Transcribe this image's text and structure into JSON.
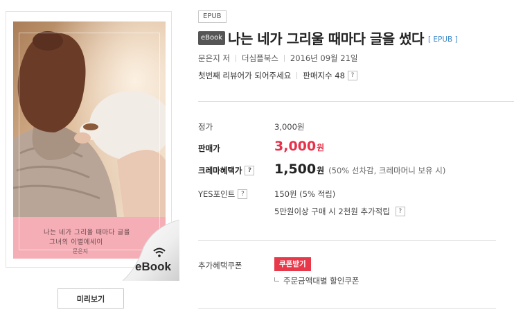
{
  "format_tag": "EPUB",
  "title_row": {
    "ebook_chip": "eBook",
    "title": "나는 네가 그리울 때마다 글을 썼다",
    "format_link": "[ EPUB ]"
  },
  "meta": {
    "author": "문은지 저",
    "publisher": "더심플북스",
    "date": "2016년 09월 21일"
  },
  "review": {
    "text": "첫번째 리뷰어가 되어주세요",
    "sales_index": "판매지수 48",
    "help": "?"
  },
  "cover": {
    "title_line1": "나는 네가 그리울 때마다 글을",
    "title_line2": "그녀의 이별에세이",
    "author": "문은지",
    "badge": "eBook",
    "image_alt": "book cover",
    "colors": {
      "pink": "#f5aeb6",
      "sweater": "#b9a597",
      "hair": "#6a3c28"
    }
  },
  "preview_button": "미리보기",
  "prices": {
    "list_label": "정가",
    "list_value": "3,000원",
    "sale_label": "판매가",
    "sale_value": "3,000",
    "sale_unit": "원",
    "crema_label": "크레마혜택가",
    "crema_value": "1,500",
    "crema_unit": "원",
    "crema_note": "(50% 선차감, 크레마머니 보유 시)",
    "points_label": "YES포인트",
    "points_value": "150원 (5% 적립)",
    "extra_points": "5만원이상 구매 시 2천원 추가적립",
    "help": "?"
  },
  "coupon": {
    "label": "추가혜택쿠폰",
    "button": "쿠폰받기",
    "sub": "주문금액대별 할인쿠폰"
  },
  "colors": {
    "sale_red": "#e6314a",
    "coupon_red": "#e8394a",
    "link_blue": "#3b87c8"
  }
}
